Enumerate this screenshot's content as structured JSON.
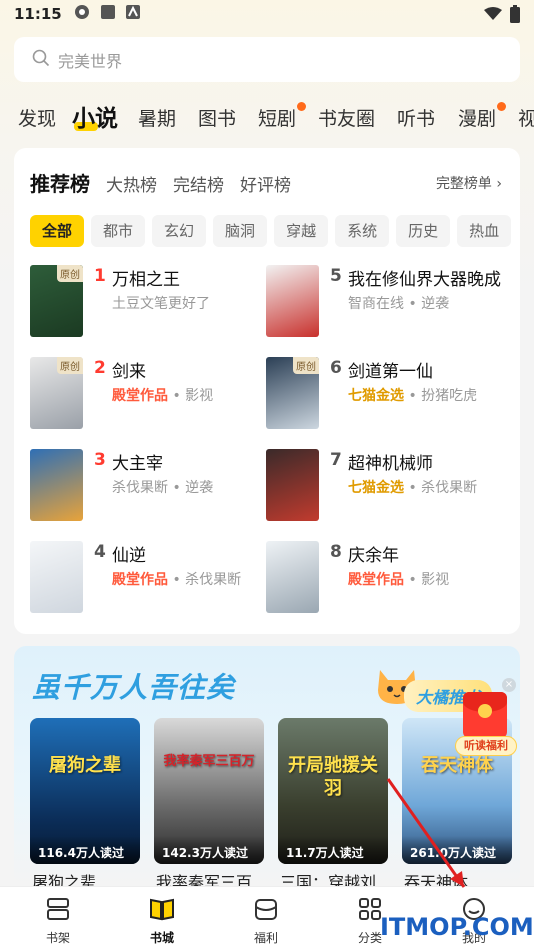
{
  "status": {
    "time": "11:15"
  },
  "search": {
    "placeholder": "完美世界"
  },
  "tabs": [
    {
      "label": "发现",
      "active": false,
      "dot": false
    },
    {
      "label": "小说",
      "active": true,
      "dot": false
    },
    {
      "label": "暑期",
      "active": false,
      "dot": false
    },
    {
      "label": "图书",
      "active": false,
      "dot": false
    },
    {
      "label": "短剧",
      "active": false,
      "dot": true
    },
    {
      "label": "书友圈",
      "active": false,
      "dot": false
    },
    {
      "label": "听书",
      "active": false,
      "dot": false
    },
    {
      "label": "漫剧",
      "active": false,
      "dot": true
    },
    {
      "label": "视",
      "active": false,
      "dot": false
    }
  ],
  "ranking": {
    "title": "推荐榜",
    "subtabs": [
      "大热榜",
      "完结榜",
      "好评榜"
    ],
    "more": "完整榜单",
    "chips": [
      "全部",
      "都市",
      "玄幻",
      "脑洞",
      "穿越",
      "系统",
      "历史",
      "热血"
    ],
    "books": [
      {
        "rank": "1",
        "name": "万相之王",
        "sub": "土豆文笔更好了",
        "sub_prefix": "",
        "tag": "原创"
      },
      {
        "rank": "2",
        "name": "剑来",
        "sub_prefix": "殿堂作品",
        "sub": "影视",
        "tag": "原创"
      },
      {
        "rank": "3",
        "name": "大主宰",
        "sub_prefix": "",
        "sub": "杀伐果断 • 逆袭",
        "tag": ""
      },
      {
        "rank": "4",
        "name": "仙逆",
        "sub_prefix": "殿堂作品",
        "sub": "杀伐果断",
        "tag": ""
      },
      {
        "rank": "5",
        "name": "我在修仙界大器晚成",
        "sub_prefix": "",
        "sub": "智商在线 • 逆袭",
        "tag": ""
      },
      {
        "rank": "6",
        "name": "剑道第一仙",
        "sub_prefix": "七猫金选",
        "sub": "扮猪吃虎",
        "tag": "原创"
      },
      {
        "rank": "7",
        "name": "超神机械师",
        "sub_prefix": "七猫金选",
        "sub": "杀伐果断",
        "tag": ""
      },
      {
        "rank": "8",
        "name": "庆余年",
        "sub_prefix": "殿堂作品",
        "sub": "影视",
        "tag": ""
      }
    ]
  },
  "promo": {
    "title": "虽千万人吾往矣",
    "badge": "大橘推书",
    "books": [
      {
        "reads": "116.4万人读过",
        "title": "屠狗之辈",
        "cover_text": "屠狗之辈"
      },
      {
        "reads": "142.3万人读过",
        "title": "我率秦军三百",
        "cover_text": "我率秦军三百万"
      },
      {
        "reads": "11.7万人读过",
        "title": "三国：穿越刘",
        "cover_text": "开局驰援关羽"
      },
      {
        "reads": "261.0万人读过",
        "title": "吞天神体",
        "cover_text": "吞天神体"
      }
    ]
  },
  "gift": {
    "label": "听读福利"
  },
  "nav": [
    {
      "label": "书架",
      "active": false,
      "icon": "bookshelf-icon"
    },
    {
      "label": "书城",
      "active": true,
      "icon": "bookstore-icon"
    },
    {
      "label": "福利",
      "active": false,
      "icon": "welfare-icon"
    },
    {
      "label": "分类",
      "active": false,
      "icon": "category-icon"
    },
    {
      "label": "我的",
      "active": false,
      "icon": "profile-icon"
    }
  ],
  "watermark": "ITMOP.COM",
  "colors": {
    "accent": "#ffd200",
    "hot": "#ff5a3c",
    "gold": "#e09b00",
    "rank_red": "#ff3b30"
  }
}
